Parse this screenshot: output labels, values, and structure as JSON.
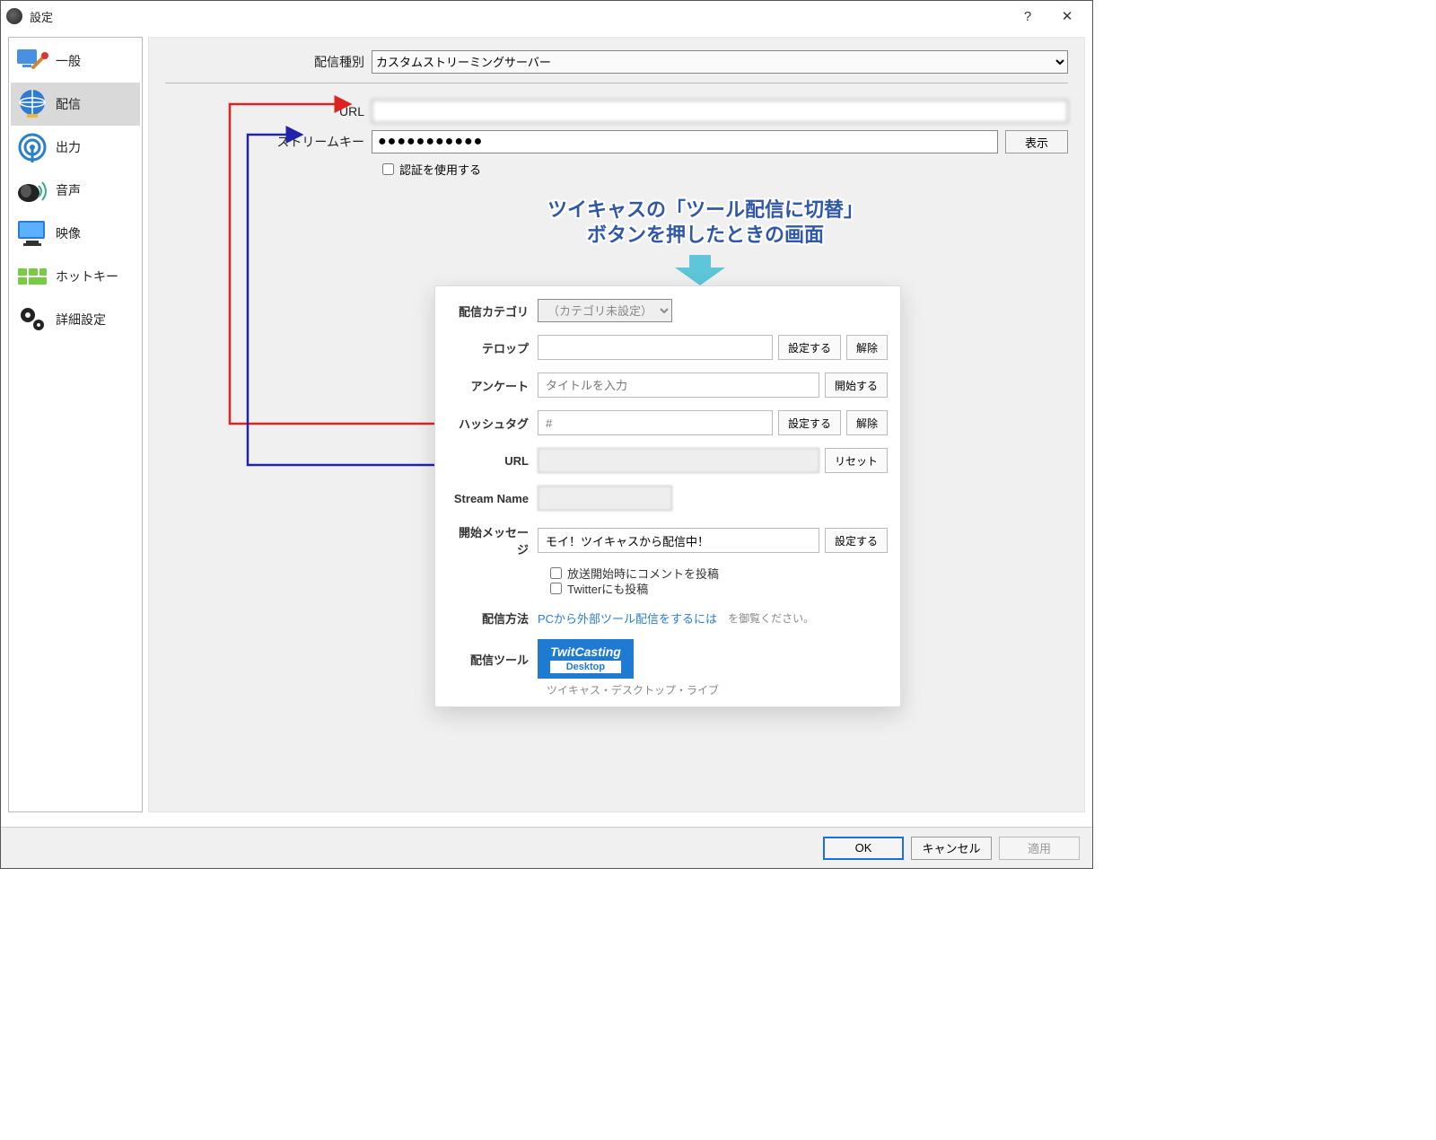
{
  "window": {
    "title": "設定"
  },
  "sidebar": {
    "items": [
      {
        "label": "一般"
      },
      {
        "label": "配信"
      },
      {
        "label": "出力"
      },
      {
        "label": "音声"
      },
      {
        "label": "映像"
      },
      {
        "label": "ホットキー"
      },
      {
        "label": "詳細設定"
      }
    ],
    "selected_index": 1
  },
  "form": {
    "service_label": "配信種別",
    "service_value": "カスタムストリーミングサーバー",
    "url_label": "URL",
    "url_value": "",
    "key_label": "ストリームキー",
    "key_value": "●●●●●●●●●●●",
    "show_button": "表示",
    "auth_label": "認証を使用する"
  },
  "annotation": {
    "line1": "ツイキャスの「ツール配信に切替」",
    "line2": "ボタンを押したときの画面"
  },
  "twc": {
    "category_label": "配信カテゴリ",
    "category_value": "（カテゴリ未設定）",
    "telop_label": "テロップ",
    "telop_set": "設定する",
    "telop_clear": "解除",
    "poll_label": "アンケート",
    "poll_placeholder": "タイトルを入力",
    "poll_start": "開始する",
    "hash_label": "ハッシュタグ",
    "hash_placeholder": "#",
    "hash_set": "設定する",
    "hash_clear": "解除",
    "url_label": "URL",
    "url_reset": "リセット",
    "stream_label": "Stream Name",
    "msg_label": "開始メッセージ",
    "msg_value": "モイ！ツイキャスから配信中！",
    "msg_set": "設定する",
    "ck1": "放送開始時にコメントを投稿",
    "ck2": "Twitterにも投稿",
    "method_label": "配信方法",
    "method_link": "PCから外部ツール配信をするには",
    "method_tail": "を御覧ください。",
    "tool_label": "配信ツール",
    "tool_badge_top": "TwitCasting",
    "tool_badge_bottom": "Desktop",
    "tool_caption": "ツイキャス・デスクトップ・ライブ"
  },
  "footer": {
    "ok": "OK",
    "cancel": "キャンセル",
    "apply": "適用"
  }
}
